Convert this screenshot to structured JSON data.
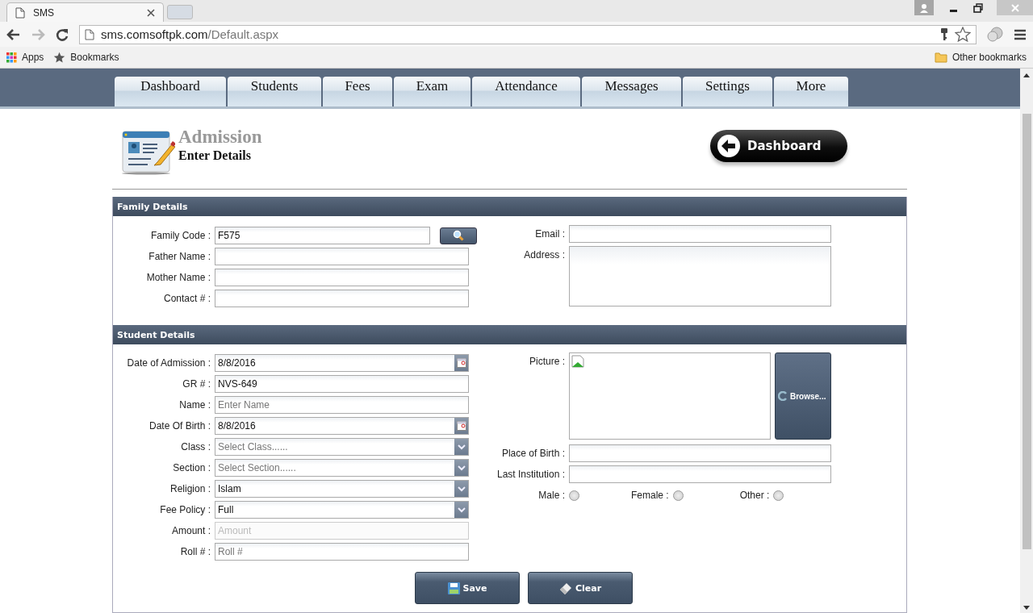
{
  "browser": {
    "tabs": [
      {
        "title": "SMS",
        "selected": true
      }
    ],
    "address": {
      "host": "sms.comsoftpk.com",
      "path": "/Default.aspx"
    },
    "bookmarks": [
      "Apps",
      "Bookmarks"
    ],
    "other_bookmarks": "Other bookmarks"
  },
  "nav": [
    "Dashboard",
    "Students",
    "Fees",
    "Exam",
    "Attendance",
    "Messages",
    "Settings",
    "More"
  ],
  "header": {
    "title": "Admission",
    "subtitle": "Enter Details",
    "dashboard_button": "Dashboard"
  },
  "family": {
    "title": "Family Details",
    "left_fields": [
      {
        "label": "Family Code :",
        "kind": "lookup",
        "value": "F575"
      },
      {
        "label": "Father Name :",
        "kind": "text"
      },
      {
        "label": "Mother Name :",
        "kind": "text"
      },
      {
        "label": "Contact # :",
        "kind": "text"
      }
    ],
    "right_fields": [
      {
        "label": "Email :",
        "kind": "text"
      },
      {
        "label": "Address :",
        "kind": "textarea"
      }
    ]
  },
  "student": {
    "title": "Student Details",
    "left_fields": [
      {
        "label": "Date of Admission :",
        "kind": "date",
        "value": "8/8/2016",
        "disabled": false
      },
      {
        "label": "GR # :",
        "kind": "text",
        "value": "NVS-649",
        "disabled": false
      },
      {
        "label": "Name :",
        "kind": "text",
        "placeholder": "Enter Name",
        "disabled": false
      },
      {
        "label": "Date Of Birth :",
        "kind": "date",
        "value": "8/8/2016",
        "disabled": false
      },
      {
        "label": "Class :",
        "kind": "select",
        "placeholder": "Select Class......",
        "disabled": false
      },
      {
        "label": "Section :",
        "kind": "select",
        "placeholder": "Select Section......",
        "disabled": false
      },
      {
        "label": "Religion :",
        "kind": "select",
        "value": "Islam",
        "disabled": false
      },
      {
        "label": "Fee Policy :",
        "kind": "select",
        "value": "Full",
        "disabled": false
      },
      {
        "label": "Amount :",
        "kind": "text",
        "placeholder": "Amount",
        "disabled": true
      },
      {
        "label": "Roll # :",
        "kind": "text",
        "placeholder": "Roll #",
        "disabled": false
      }
    ],
    "picture_label": "Picture :",
    "browse_button": "Browse...",
    "right_fields": [
      {
        "label": "Place of Birth :",
        "kind": "text"
      },
      {
        "label": "Last Institution :",
        "kind": "text"
      }
    ],
    "gender": [
      {
        "label": "Male :",
        "selected": false
      },
      {
        "label": "Female :",
        "selected": false
      },
      {
        "label": "Other :",
        "selected": false
      }
    ]
  },
  "buttons": [
    {
      "label": "Save",
      "kind": "save"
    },
    {
      "label": "Clear",
      "kind": "clear"
    }
  ]
}
